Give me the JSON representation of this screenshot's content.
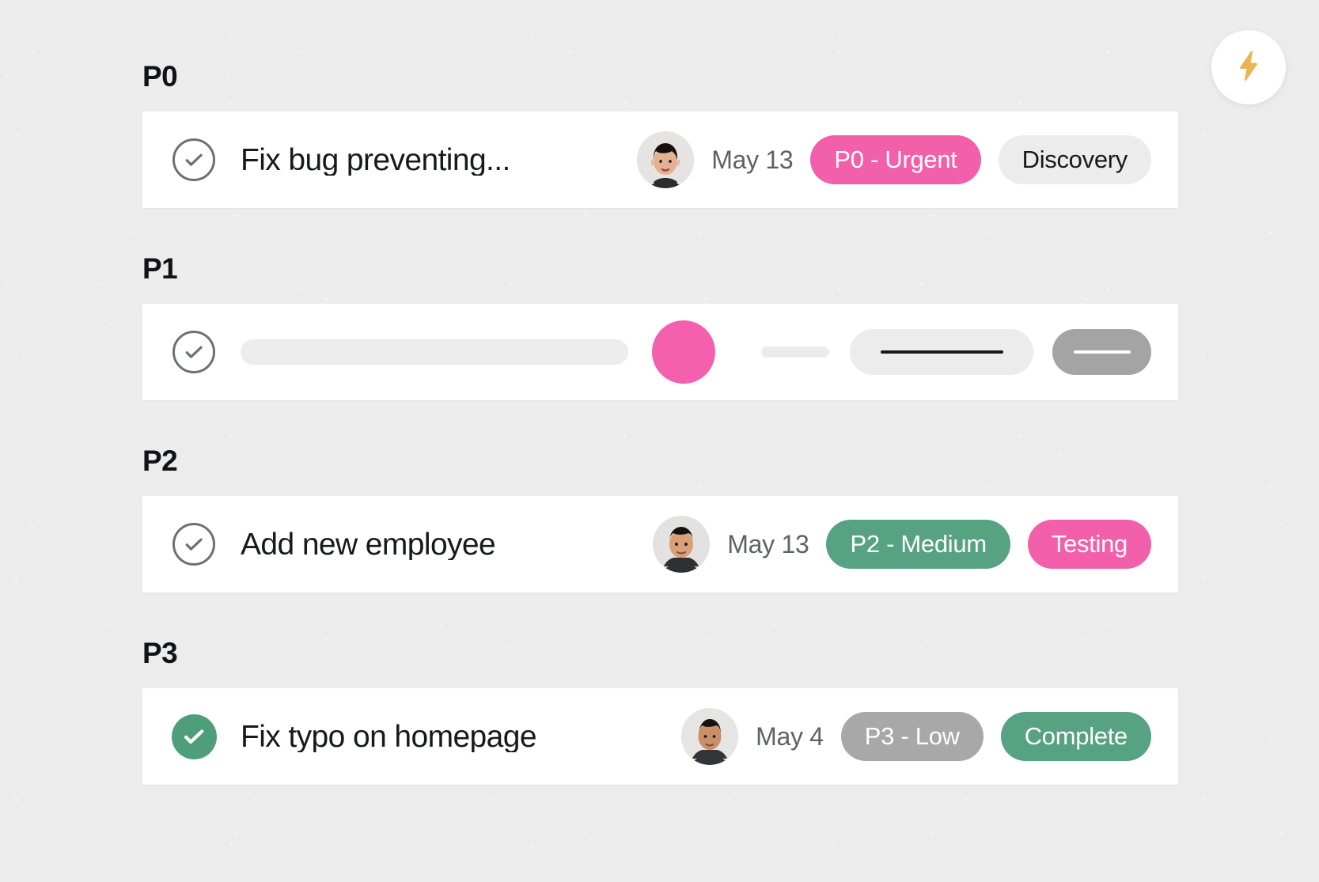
{
  "fab": {
    "icon": "lightning-bolt-icon",
    "icon_color": "#eeb košer"
  },
  "colors": {
    "background": "#ececec",
    "card": "#ffffff",
    "accent_pink": "#f25fab",
    "accent_green": "#56a283",
    "accent_gray": "#a8a8a8",
    "bolt": "#eab354"
  },
  "groups": [
    {
      "title": "P0",
      "task": {
        "state": "incomplete",
        "check_icon": "check-circle-outline-icon",
        "title": "Fix bug preventing...",
        "avatar": "avatar-woman-short-hair",
        "date": "May 13",
        "priority_badge": {
          "label": "P0 - Urgent",
          "style": "pink"
        },
        "status_badge": {
          "label": "Discovery",
          "style": "gray-light"
        }
      }
    },
    {
      "title": "P1",
      "task": {
        "state": "loading",
        "check_icon": "check-circle-outline-icon",
        "title": "",
        "avatar": "",
        "date": "",
        "priority_badge": {
          "label": "",
          "style": "skeleton-light"
        },
        "status_badge": {
          "label": "",
          "style": "skeleton-dark"
        }
      }
    },
    {
      "title": "P2",
      "task": {
        "state": "incomplete",
        "check_icon": "check-circle-outline-icon",
        "title": "Add new employee",
        "avatar": "avatar-man-dark-shirt",
        "date": "May 13",
        "priority_badge": {
          "label": "P2 - Medium",
          "style": "green"
        },
        "status_badge": {
          "label": "Testing",
          "style": "pink"
        }
      }
    },
    {
      "title": "P3",
      "task": {
        "state": "complete",
        "check_icon": "check-circle-filled-icon",
        "title": "Fix typo on homepage",
        "avatar": "avatar-man-short-hair",
        "date": "May 4",
        "priority_badge": {
          "label": "P3 - Low",
          "style": "gray"
        },
        "status_badge": {
          "label": "Complete",
          "style": "green"
        }
      }
    }
  ]
}
